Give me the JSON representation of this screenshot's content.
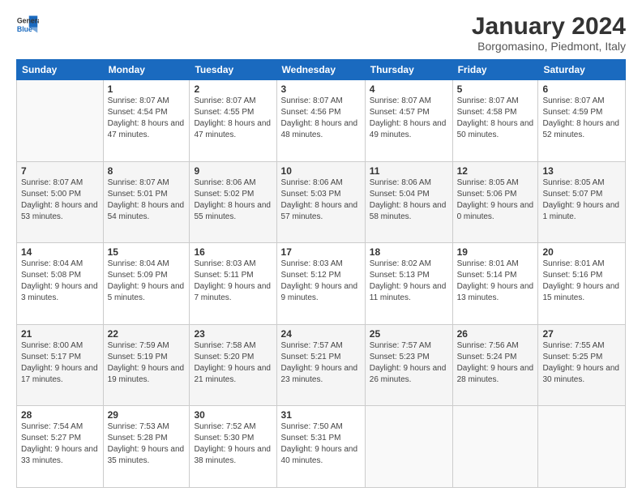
{
  "logo": {
    "line1": "General",
    "line2": "Blue"
  },
  "header": {
    "title": "January 2024",
    "subtitle": "Borgomasino, Piedmont, Italy"
  },
  "weekdays": [
    "Sunday",
    "Monday",
    "Tuesday",
    "Wednesday",
    "Thursday",
    "Friday",
    "Saturday"
  ],
  "weeks": [
    [
      {
        "day": "",
        "sunrise": "",
        "sunset": "",
        "daylight": ""
      },
      {
        "day": "1",
        "sunrise": "Sunrise: 8:07 AM",
        "sunset": "Sunset: 4:54 PM",
        "daylight": "Daylight: 8 hours and 47 minutes."
      },
      {
        "day": "2",
        "sunrise": "Sunrise: 8:07 AM",
        "sunset": "Sunset: 4:55 PM",
        "daylight": "Daylight: 8 hours and 47 minutes."
      },
      {
        "day": "3",
        "sunrise": "Sunrise: 8:07 AM",
        "sunset": "Sunset: 4:56 PM",
        "daylight": "Daylight: 8 hours and 48 minutes."
      },
      {
        "day": "4",
        "sunrise": "Sunrise: 8:07 AM",
        "sunset": "Sunset: 4:57 PM",
        "daylight": "Daylight: 8 hours and 49 minutes."
      },
      {
        "day": "5",
        "sunrise": "Sunrise: 8:07 AM",
        "sunset": "Sunset: 4:58 PM",
        "daylight": "Daylight: 8 hours and 50 minutes."
      },
      {
        "day": "6",
        "sunrise": "Sunrise: 8:07 AM",
        "sunset": "Sunset: 4:59 PM",
        "daylight": "Daylight: 8 hours and 52 minutes."
      }
    ],
    [
      {
        "day": "7",
        "sunrise": "Sunrise: 8:07 AM",
        "sunset": "Sunset: 5:00 PM",
        "daylight": "Daylight: 8 hours and 53 minutes."
      },
      {
        "day": "8",
        "sunrise": "Sunrise: 8:07 AM",
        "sunset": "Sunset: 5:01 PM",
        "daylight": "Daylight: 8 hours and 54 minutes."
      },
      {
        "day": "9",
        "sunrise": "Sunrise: 8:06 AM",
        "sunset": "Sunset: 5:02 PM",
        "daylight": "Daylight: 8 hours and 55 minutes."
      },
      {
        "day": "10",
        "sunrise": "Sunrise: 8:06 AM",
        "sunset": "Sunset: 5:03 PM",
        "daylight": "Daylight: 8 hours and 57 minutes."
      },
      {
        "day": "11",
        "sunrise": "Sunrise: 8:06 AM",
        "sunset": "Sunset: 5:04 PM",
        "daylight": "Daylight: 8 hours and 58 minutes."
      },
      {
        "day": "12",
        "sunrise": "Sunrise: 8:05 AM",
        "sunset": "Sunset: 5:06 PM",
        "daylight": "Daylight: 9 hours and 0 minutes."
      },
      {
        "day": "13",
        "sunrise": "Sunrise: 8:05 AM",
        "sunset": "Sunset: 5:07 PM",
        "daylight": "Daylight: 9 hours and 1 minute."
      }
    ],
    [
      {
        "day": "14",
        "sunrise": "Sunrise: 8:04 AM",
        "sunset": "Sunset: 5:08 PM",
        "daylight": "Daylight: 9 hours and 3 minutes."
      },
      {
        "day": "15",
        "sunrise": "Sunrise: 8:04 AM",
        "sunset": "Sunset: 5:09 PM",
        "daylight": "Daylight: 9 hours and 5 minutes."
      },
      {
        "day": "16",
        "sunrise": "Sunrise: 8:03 AM",
        "sunset": "Sunset: 5:11 PM",
        "daylight": "Daylight: 9 hours and 7 minutes."
      },
      {
        "day": "17",
        "sunrise": "Sunrise: 8:03 AM",
        "sunset": "Sunset: 5:12 PM",
        "daylight": "Daylight: 9 hours and 9 minutes."
      },
      {
        "day": "18",
        "sunrise": "Sunrise: 8:02 AM",
        "sunset": "Sunset: 5:13 PM",
        "daylight": "Daylight: 9 hours and 11 minutes."
      },
      {
        "day": "19",
        "sunrise": "Sunrise: 8:01 AM",
        "sunset": "Sunset: 5:14 PM",
        "daylight": "Daylight: 9 hours and 13 minutes."
      },
      {
        "day": "20",
        "sunrise": "Sunrise: 8:01 AM",
        "sunset": "Sunset: 5:16 PM",
        "daylight": "Daylight: 9 hours and 15 minutes."
      }
    ],
    [
      {
        "day": "21",
        "sunrise": "Sunrise: 8:00 AM",
        "sunset": "Sunset: 5:17 PM",
        "daylight": "Daylight: 9 hours and 17 minutes."
      },
      {
        "day": "22",
        "sunrise": "Sunrise: 7:59 AM",
        "sunset": "Sunset: 5:19 PM",
        "daylight": "Daylight: 9 hours and 19 minutes."
      },
      {
        "day": "23",
        "sunrise": "Sunrise: 7:58 AM",
        "sunset": "Sunset: 5:20 PM",
        "daylight": "Daylight: 9 hours and 21 minutes."
      },
      {
        "day": "24",
        "sunrise": "Sunrise: 7:57 AM",
        "sunset": "Sunset: 5:21 PM",
        "daylight": "Daylight: 9 hours and 23 minutes."
      },
      {
        "day": "25",
        "sunrise": "Sunrise: 7:57 AM",
        "sunset": "Sunset: 5:23 PM",
        "daylight": "Daylight: 9 hours and 26 minutes."
      },
      {
        "day": "26",
        "sunrise": "Sunrise: 7:56 AM",
        "sunset": "Sunset: 5:24 PM",
        "daylight": "Daylight: 9 hours and 28 minutes."
      },
      {
        "day": "27",
        "sunrise": "Sunrise: 7:55 AM",
        "sunset": "Sunset: 5:25 PM",
        "daylight": "Daylight: 9 hours and 30 minutes."
      }
    ],
    [
      {
        "day": "28",
        "sunrise": "Sunrise: 7:54 AM",
        "sunset": "Sunset: 5:27 PM",
        "daylight": "Daylight: 9 hours and 33 minutes."
      },
      {
        "day": "29",
        "sunrise": "Sunrise: 7:53 AM",
        "sunset": "Sunset: 5:28 PM",
        "daylight": "Daylight: 9 hours and 35 minutes."
      },
      {
        "day": "30",
        "sunrise": "Sunrise: 7:52 AM",
        "sunset": "Sunset: 5:30 PM",
        "daylight": "Daylight: 9 hours and 38 minutes."
      },
      {
        "day": "31",
        "sunrise": "Sunrise: 7:50 AM",
        "sunset": "Sunset: 5:31 PM",
        "daylight": "Daylight: 9 hours and 40 minutes."
      },
      {
        "day": "",
        "sunrise": "",
        "sunset": "",
        "daylight": ""
      },
      {
        "day": "",
        "sunrise": "",
        "sunset": "",
        "daylight": ""
      },
      {
        "day": "",
        "sunrise": "",
        "sunset": "",
        "daylight": ""
      }
    ]
  ]
}
